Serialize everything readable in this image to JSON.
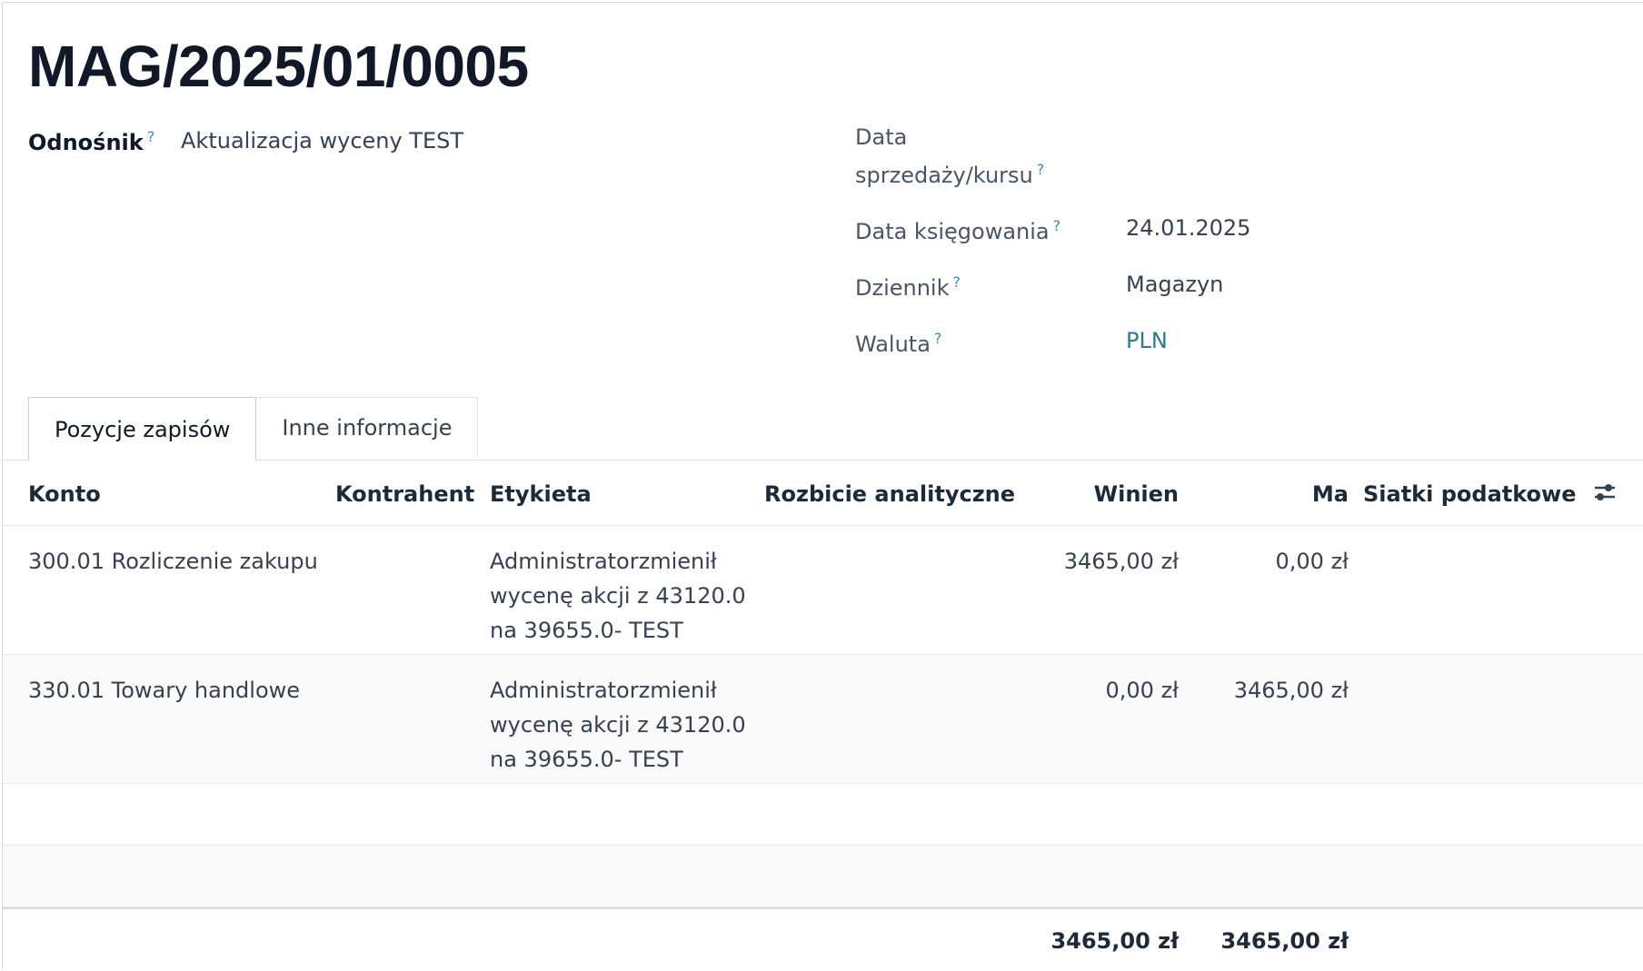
{
  "title": "MAG/2025/01/0005",
  "help_mark": "?",
  "fields": {
    "ref_label": "Odnośnik",
    "ref_value": "Aktualizacja wyceny TEST",
    "sale_date_label_1": "Data",
    "sale_date_label_2": "sprzedaży/kursu",
    "posting_date_label": "Data księgowania",
    "posting_date_value": "24.01.2025",
    "journal_label": "Dziennik",
    "journal_value": "Magazyn",
    "currency_label": "Waluta",
    "currency_value": "PLN"
  },
  "tabs": [
    {
      "label": "Pozycje zapisów",
      "active": true
    },
    {
      "label": "Inne informacje",
      "active": false
    }
  ],
  "columns": {
    "account": "Konto",
    "partner": "Kontrahent",
    "label": "Etykieta",
    "analytic": "Rozbicie analityczne",
    "debit": "Winien",
    "credit": "Ma",
    "tax_grids": "Siatki podatkowe"
  },
  "rows": [
    {
      "account": "300.01 Rozliczenie zakupu",
      "label_1": "Administratorzmienił",
      "label_2": "wycenę akcji z 43120.0",
      "label_3": "na 39655.0- TEST",
      "debit": "3465,00 zł",
      "credit": "0,00 zł"
    },
    {
      "account": "330.01 Towary handlowe",
      "label_1": "Administratorzmienił",
      "label_2": "wycenę akcji z 43120.0",
      "label_3": "na 39655.0- TEST",
      "debit": "0,00 zł",
      "credit": "3465,00 zł"
    }
  ],
  "totals": {
    "debit": "3465,00 zł",
    "credit": "3465,00 zł"
  },
  "icons": {
    "column_settings": "sliders-icon",
    "help": "question-mark"
  },
  "colors": {
    "link": "#2c7a88",
    "help": "#3e8e9e"
  }
}
